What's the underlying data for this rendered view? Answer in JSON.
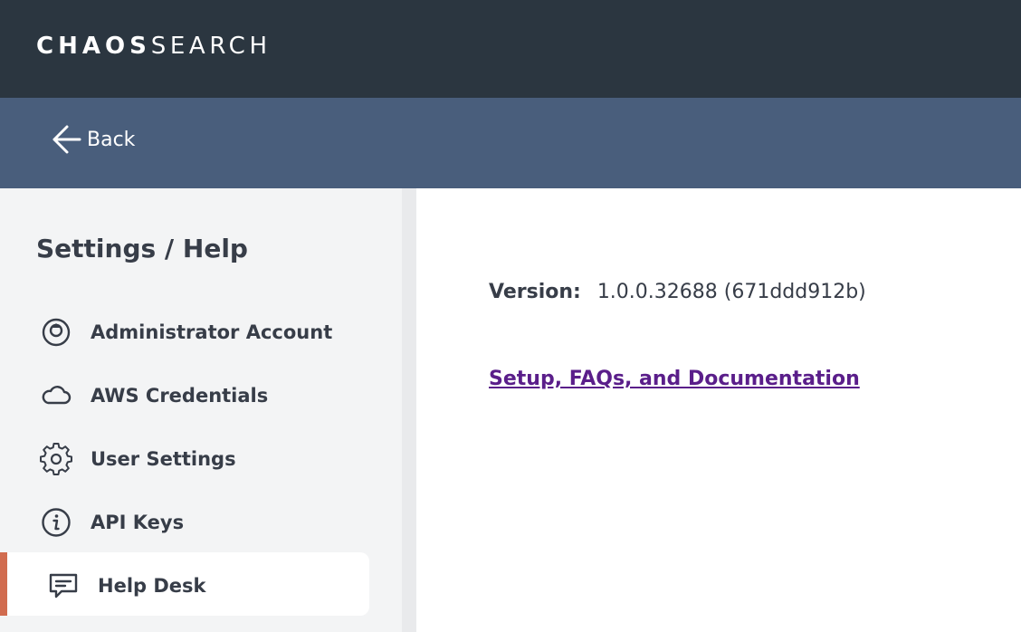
{
  "header": {
    "logo_bold": "CHAOS",
    "logo_light": "SEARCH"
  },
  "backbar": {
    "back_label": "Back"
  },
  "sidebar": {
    "title": "Settings / Help",
    "items": [
      {
        "label": "Administrator Account",
        "icon": "user-circle-icon",
        "active": false
      },
      {
        "label": "AWS Credentials",
        "icon": "cloud-icon",
        "active": false
      },
      {
        "label": "User Settings",
        "icon": "gear-icon",
        "active": false
      },
      {
        "label": "API Keys",
        "icon": "info-icon",
        "active": false
      },
      {
        "label": "Help Desk",
        "icon": "chat-icon",
        "active": true
      }
    ]
  },
  "main": {
    "version_label": "Version:",
    "version_value": "1.0.0.32688 (671ddd912b)",
    "doc_link": "Setup, FAQs, and Documentation"
  },
  "colors": {
    "topbar": "#2b3640",
    "backbar": "#495e7c",
    "sidebar": "#f3f4f5",
    "active_accent": "#d16c4f",
    "link": "#5a1e8a",
    "text": "#373d48"
  }
}
